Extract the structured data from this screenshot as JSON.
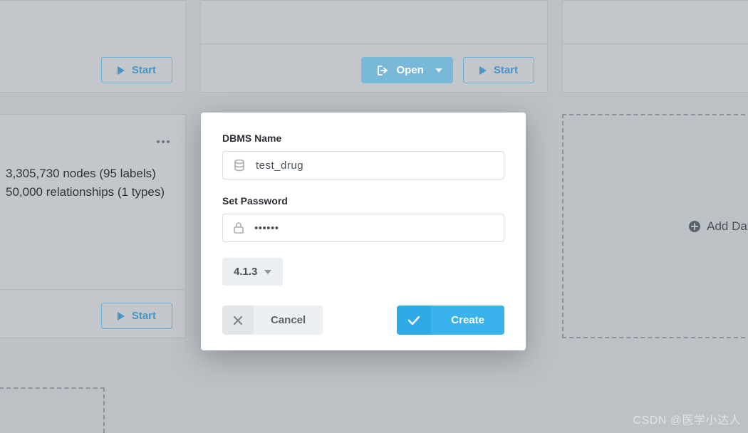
{
  "colors": {
    "accent": "#3ab3ec",
    "accent_outline": "#68afd6",
    "bg": "#bcc1c6"
  },
  "buttons": {
    "start": "Start",
    "open": "Open"
  },
  "card_left": {
    "line1": "3,305,730 nodes (95 labels)",
    "line2": "50,000 relationships (1 types)"
  },
  "add_db_label": "Add Database",
  "modal": {
    "name_label": "DBMS Name",
    "name_value": "test_drug",
    "pwd_label": "Set Password",
    "pwd_value": "******",
    "version": "4.1.3",
    "cancel": "Cancel",
    "create": "Create"
  },
  "watermark": "CSDN @医学小达人"
}
